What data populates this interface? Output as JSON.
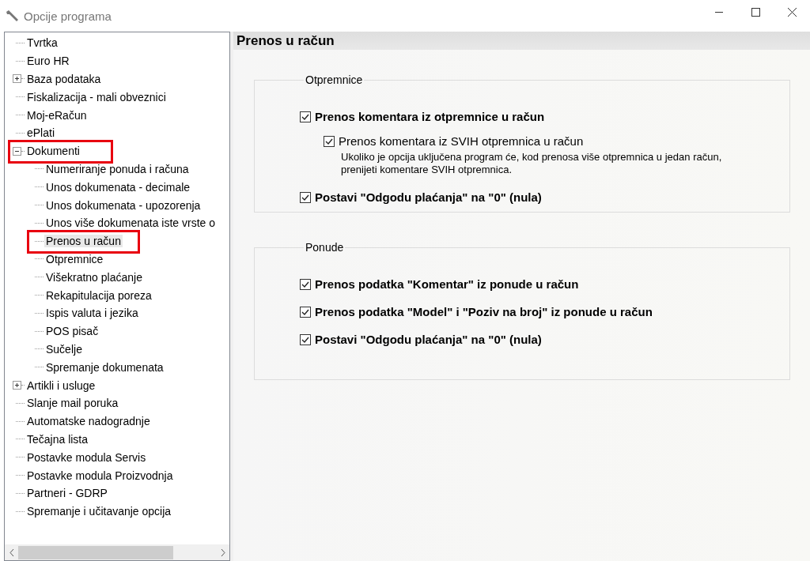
{
  "window": {
    "title": "Opcije programa"
  },
  "tree": [
    {
      "label": "Tvrtka",
      "kind": "leaf",
      "selected": false,
      "marked": false
    },
    {
      "label": "Euro HR",
      "kind": "leaf",
      "selected": false,
      "marked": false
    },
    {
      "label": "Baza podataka",
      "kind": "folder",
      "expanded": false,
      "selected": false,
      "marked": false
    },
    {
      "label": "Fiskalizacija - mali obveznici",
      "kind": "leaf",
      "selected": false,
      "marked": false
    },
    {
      "label": "Moj-eRačun",
      "kind": "leaf",
      "selected": false,
      "marked": false
    },
    {
      "label": "ePlati",
      "kind": "leaf",
      "selected": false,
      "marked": false
    },
    {
      "label": "Dokumenti",
      "kind": "folder",
      "expanded": true,
      "selected": false,
      "marked": true,
      "children": [
        {
          "label": "Numeriranje ponuda i računa",
          "kind": "leaf",
          "selected": false,
          "marked": false
        },
        {
          "label": "Unos dokumenata - decimale",
          "kind": "leaf",
          "selected": false,
          "marked": false
        },
        {
          "label": "Unos dokumenata - upozorenja",
          "kind": "leaf",
          "selected": false,
          "marked": false
        },
        {
          "label": "Unos više dokumenata iste vrste o",
          "kind": "leaf",
          "selected": false,
          "marked": false
        },
        {
          "label": "Prenos u račun",
          "kind": "leaf",
          "selected": true,
          "marked": true
        },
        {
          "label": "Otpremnice",
          "kind": "leaf",
          "selected": false,
          "marked": false
        },
        {
          "label": "Višekratno plaćanje",
          "kind": "leaf",
          "selected": false,
          "marked": false
        },
        {
          "label": "Rekapitulacija poreza",
          "kind": "leaf",
          "selected": false,
          "marked": false
        },
        {
          "label": "Ispis valuta i jezika",
          "kind": "leaf",
          "selected": false,
          "marked": false
        },
        {
          "label": "POS pisač",
          "kind": "leaf",
          "selected": false,
          "marked": false
        },
        {
          "label": "Sučelje",
          "kind": "leaf",
          "selected": false,
          "marked": false
        },
        {
          "label": "Spremanje dokumenata",
          "kind": "leaf",
          "selected": false,
          "marked": false
        }
      ]
    },
    {
      "label": "Artikli i usluge",
      "kind": "folder",
      "expanded": false,
      "selected": false,
      "marked": false
    },
    {
      "label": "Slanje mail poruka",
      "kind": "leaf",
      "selected": false,
      "marked": false
    },
    {
      "label": "Automatske nadogradnje",
      "kind": "leaf",
      "selected": false,
      "marked": false
    },
    {
      "label": "Tečajna lista",
      "kind": "leaf",
      "selected": false,
      "marked": false
    },
    {
      "label": "Postavke modula Servis",
      "kind": "leaf",
      "selected": false,
      "marked": false
    },
    {
      "label": "Postavke modula Proizvodnja",
      "kind": "leaf",
      "selected": false,
      "marked": false
    },
    {
      "label": "Partneri - GDRP",
      "kind": "leaf",
      "selected": false,
      "marked": false
    },
    {
      "label": "Spremanje i učitavanje opcija",
      "kind": "leaf",
      "selected": false,
      "marked": false
    }
  ],
  "page": {
    "title": "Prenos u račun",
    "groups": [
      {
        "title": "Otpremnice",
        "options": [
          {
            "kind": "main",
            "label": "Prenos komentara iz otpremnice u račun",
            "checked": true
          },
          {
            "kind": "sub",
            "label": "Prenos komentara iz SVIH otpremnica u račun",
            "checked": true,
            "description": "Ukoliko je opcija uključena program će, kod prenosa više otpremnica u jedan račun, prenijeti komentare SVIH otpremnica."
          },
          {
            "kind": "main",
            "label": "Postavi \"Odgodu plaćanja\" na \"0\" (nula)",
            "checked": true
          }
        ]
      },
      {
        "title": "Ponude",
        "options": [
          {
            "kind": "main",
            "label": "Prenos podatka \"Komentar\" iz ponude u račun",
            "checked": true
          },
          {
            "kind": "main",
            "label": "Prenos podatka \"Model\" i \"Poziv na broj\" iz ponude u račun",
            "checked": true
          },
          {
            "kind": "main",
            "label": "Postavi \"Odgodu plaćanja\" na \"0\" (nula)",
            "checked": true
          }
        ]
      }
    ]
  }
}
